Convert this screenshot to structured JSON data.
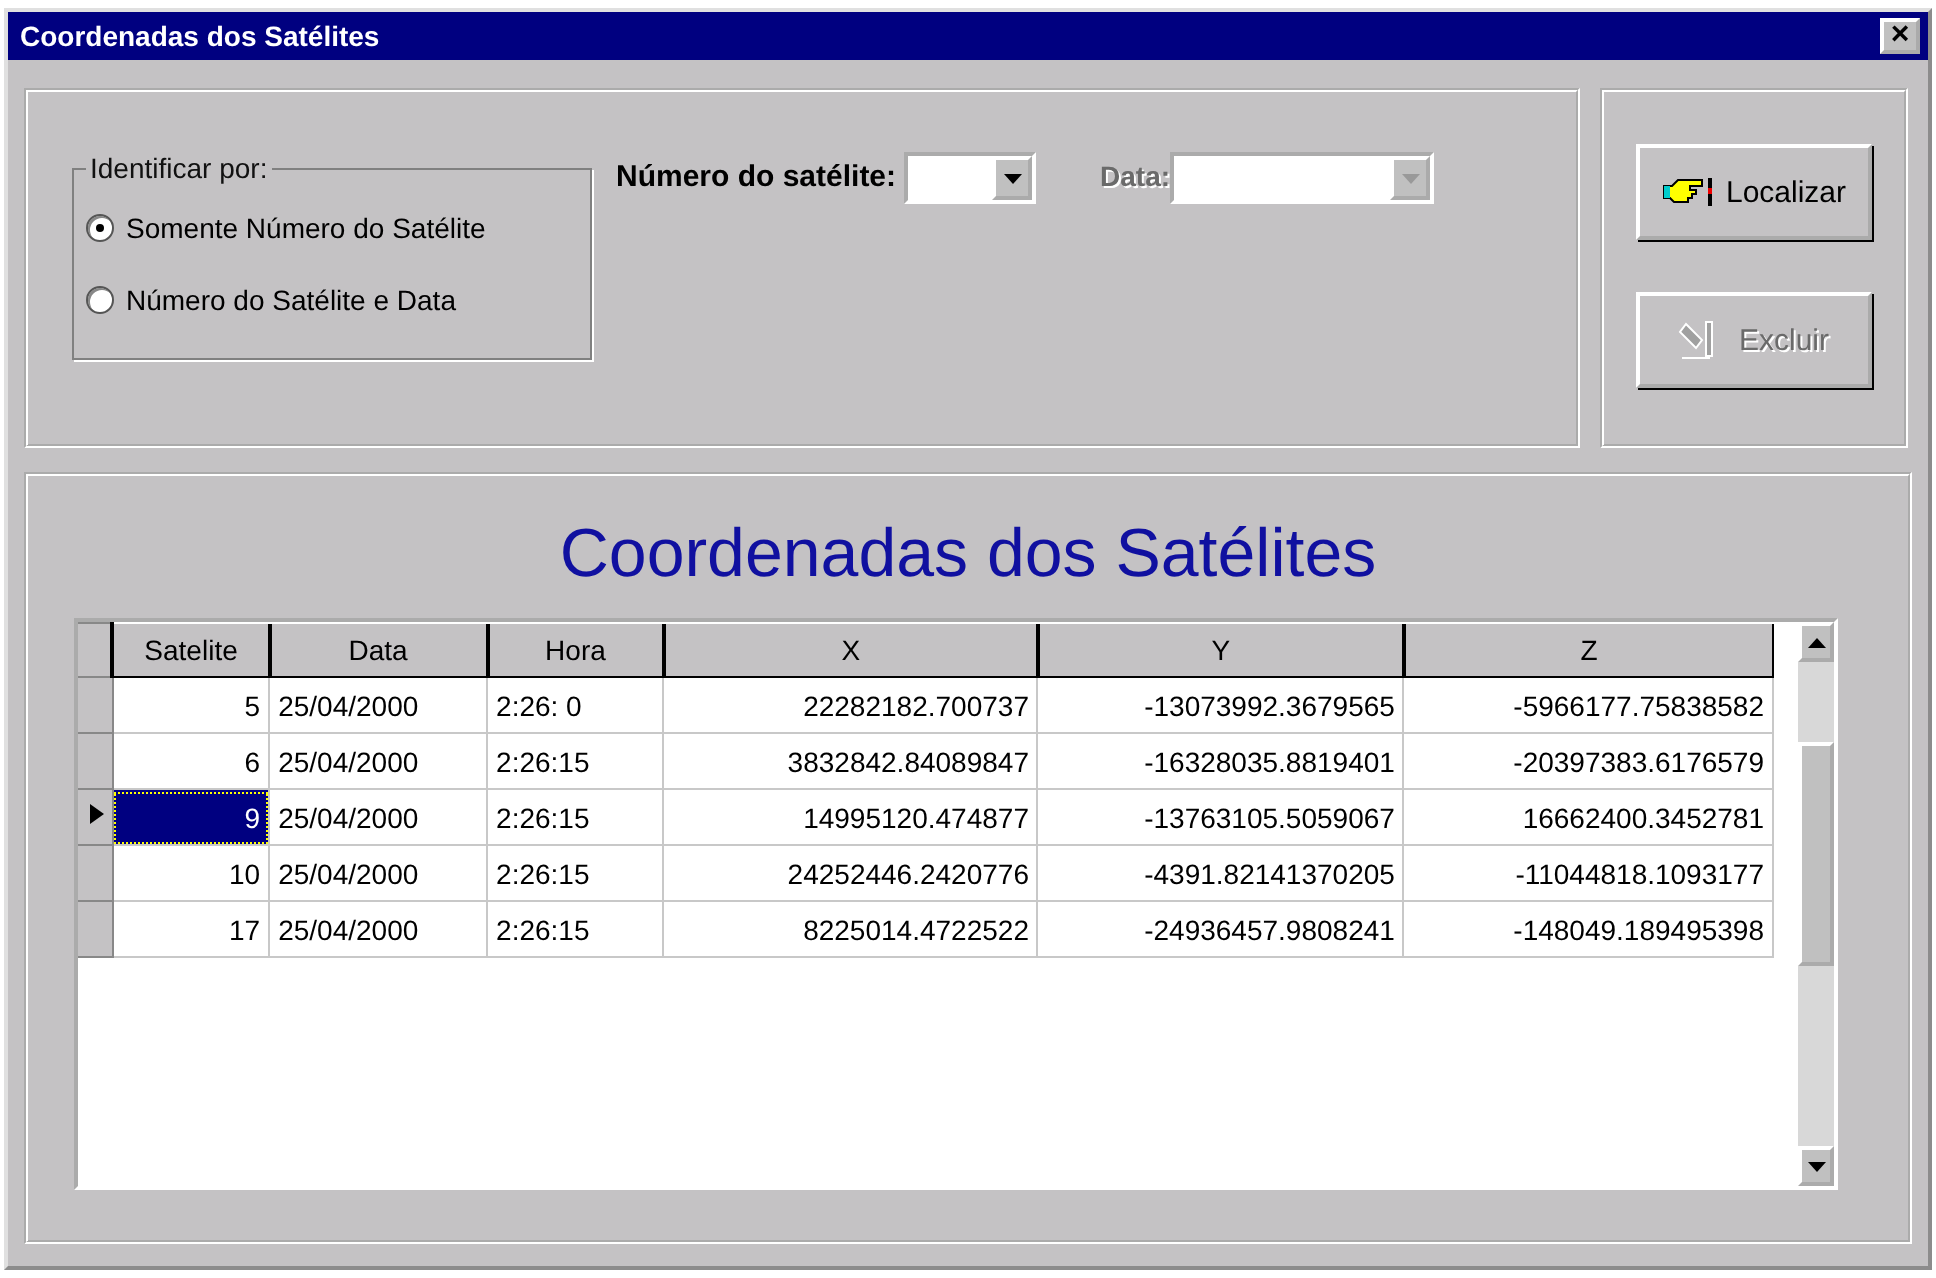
{
  "window": {
    "title": "Coordenadas dos Satélites",
    "close": "×"
  },
  "identify": {
    "legend": "Identificar por:",
    "options": [
      {
        "label": "Somente Número do Satélite",
        "selected": true
      },
      {
        "label": "Número do Satélite e Data",
        "selected": false
      }
    ]
  },
  "satellite_number": {
    "label": "Número do satélite:",
    "disabled": false
  },
  "date": {
    "label": "Data:",
    "disabled": true
  },
  "buttons": [
    {
      "label": "Localizar",
      "kind": "find",
      "disabled": false
    },
    {
      "label": "Excluir",
      "kind": "delete",
      "disabled": true
    }
  ],
  "table": {
    "title": "Coordenadas dos Satélites",
    "columns": [
      "Satelite",
      "Data",
      "Hora",
      "X",
      "Y",
      "Z"
    ],
    "rows": [
      {
        "selected": false,
        "cells": [
          "5",
          "25/04/2000",
          "2:26: 0",
          "22282182.700737",
          "-13073992.3679565",
          "-5966177.75838582"
        ]
      },
      {
        "selected": false,
        "cells": [
          "6",
          "25/04/2000",
          "2:26:15",
          "3832842.84089847",
          "-16328035.8819401",
          "-20397383.6176579"
        ]
      },
      {
        "selected": true,
        "cells": [
          "9",
          "25/04/2000",
          "2:26:15",
          "14995120.474877",
          "-13763105.5059067",
          "16662400.3452781"
        ]
      },
      {
        "selected": false,
        "cells": [
          "10",
          "25/04/2000",
          "2:26:15",
          "24252446.2420776",
          "-4391.82141370205",
          "-11044818.1093177"
        ]
      },
      {
        "selected": false,
        "cells": [
          "17",
          "25/04/2000",
          "2:26:15",
          "8225014.4722522",
          "-24936457.9808241",
          "-148049.189495398"
        ]
      }
    ]
  }
}
